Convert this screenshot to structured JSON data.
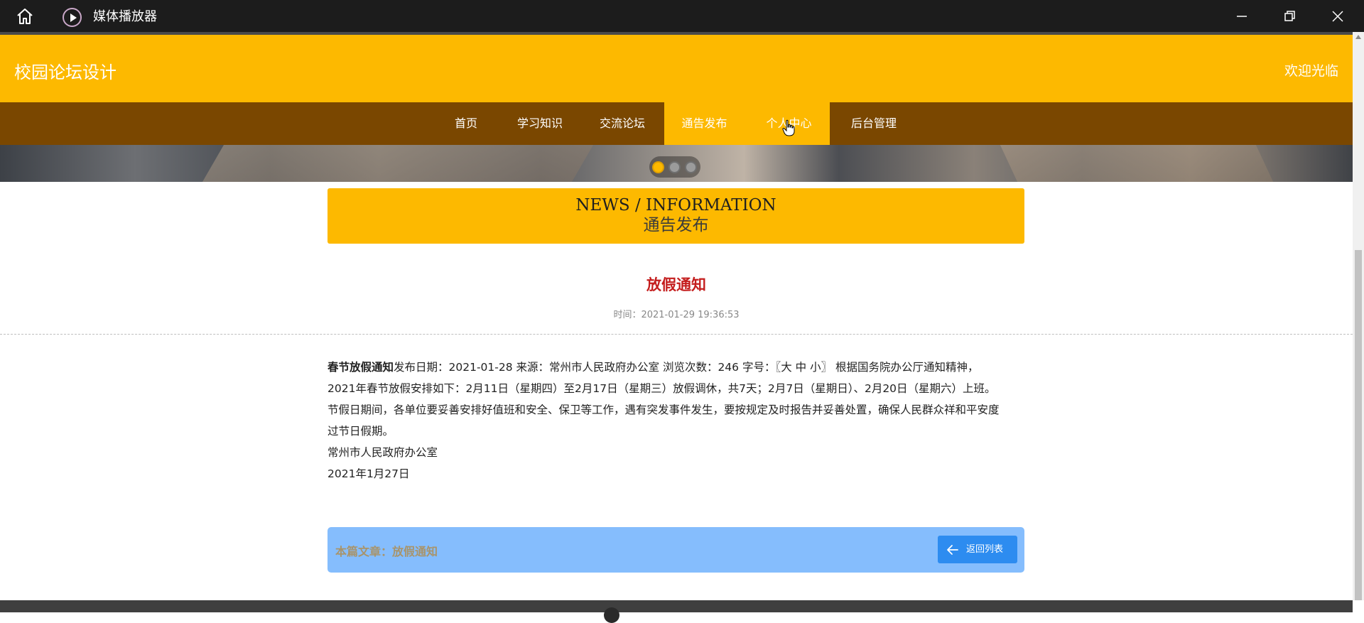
{
  "titlebar": {
    "app_title": "媒体播放器",
    "home_icon": "home-icon",
    "app_icon": "play-circle-icon"
  },
  "header": {
    "site_title": "校园论坛设计",
    "welcome": "欢迎光临"
  },
  "nav": {
    "items": [
      {
        "label": "首页"
      },
      {
        "label": "学习知识"
      },
      {
        "label": "交流论坛"
      },
      {
        "label": "通告发布",
        "active": true
      },
      {
        "label": "个人中心"
      },
      {
        "label": "后台管理"
      }
    ]
  },
  "carousel": {
    "dots": 3,
    "active_index": 0
  },
  "news_header": {
    "en": "NEWS / INFORMATION",
    "cn": "通告发布"
  },
  "article": {
    "title": "放假通知",
    "time": "时间：2021-01-29 19:36:53",
    "bold_lead": "春节放假通知",
    "line1": "发布日期：2021-01-28  来源：常州市人民政府办公室  浏览次数：246  字号：〖大 中 小〗 根据国务院办公厅通知精神，",
    "line2": "2021年春节放假安排如下：2月11日（星期四）至2月17日（星期三）放假调休，共7天；2月7日（星期日）、2月20日（星期六）上班。",
    "line3": "节假日期间，各单位要妥善安排好值班和安全、保卫等工作，遇有突发事件发生，要按规定及时报告并妥善处置，确保人民群众祥和平安度",
    "line4": "过节日假期。",
    "line5": "常州市人民政府办公室",
    "line6": "2021年1月27日"
  },
  "footer_bar": {
    "label": "本篇文章：放假通知",
    "back_button": "返回列表"
  },
  "colors": {
    "header": "#fdb900",
    "nav": "#7a4700",
    "title_red": "#c41d1d",
    "bar_blue": "#85bdfd",
    "button_blue": "#2d8cf0"
  }
}
